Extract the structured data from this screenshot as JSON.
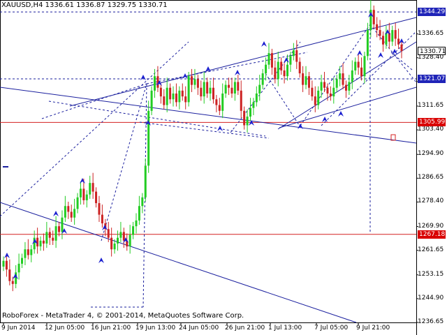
{
  "header": {
    "symbol": "XAUUSD,H4",
    "open": "1336.61",
    "high": "1336.87",
    "low": "1329.75",
    "close": "1330.71"
  },
  "footer": {
    "watermark": "RoboForex - MetaTrader 4, © 2001-2014, MetaQuotes Software Corp."
  },
  "price_axis": {
    "ticks": [
      "1336.65",
      "1328.40",
      "1320.15",
      "1311.65",
      "1303.40",
      "1294.90",
      "1286.65",
      "1278.40",
      "1269.90",
      "1261.65",
      "1253.15",
      "1244.90",
      "1236.65"
    ]
  },
  "time_axis": {
    "ticks": [
      "9 Jun 2014",
      "12 Jun 05:00",
      "16 Jun 21:00",
      "19 Jun 13:00",
      "24 Jun 05:00",
      "26 Jun 21:00",
      "1 Jul 13:00",
      "7 Jul 05:00",
      "9 Jul 21:00"
    ]
  },
  "price_labels": [
    {
      "value": "1344.29",
      "style": "resistance",
      "bg": "#1f24b8",
      "fg": "#ffffff"
    },
    {
      "value": "1330.71",
      "style": "current",
      "bg": "#ffffff",
      "fg": "#000000"
    },
    {
      "value": "1321.07",
      "style": "target",
      "bg": "#1f24b8",
      "fg": "#ffffff"
    },
    {
      "value": "1305.99",
      "style": "level",
      "bg": "#d90000",
      "fg": "#ffffff"
    },
    {
      "value": "1267.18",
      "style": "level",
      "bg": "#d90000",
      "fg": "#ffffff"
    }
  ],
  "colors": {
    "bull": "#22cc22",
    "bear": "#cc2222",
    "trend": "#1a1f9e",
    "level_red": "#d42020",
    "arrow": "#1a1fcf"
  },
  "chart_data": {
    "type": "candlestick",
    "symbol": "XAUUSD",
    "timeframe": "H4",
    "ylim": [
      1236.65,
      1349.0
    ],
    "horizontal_levels": [
      1344.29,
      1321.07,
      1305.99,
      1267.18
    ],
    "current_price": 1330.71,
    "series_close": [
      1258,
      1255,
      1251,
      1250,
      1254,
      1257,
      1259,
      1262,
      1260,
      1262,
      1266,
      1263,
      1265,
      1264,
      1268,
      1266,
      1265,
      1270,
      1268,
      1273,
      1277,
      1275,
      1273,
      1276,
      1280,
      1283,
      1279,
      1281,
      1285,
      1282,
      1278,
      1274,
      1271,
      1269,
      1266,
      1262,
      1264,
      1266,
      1268,
      1265,
      1263,
      1267,
      1270,
      1272,
      1277,
      1280,
      1291,
      1310,
      1317,
      1322,
      1318,
      1315,
      1312,
      1318,
      1314,
      1316,
      1313,
      1317,
      1315,
      1313,
      1322,
      1319,
      1321,
      1318,
      1315,
      1320,
      1316,
      1318,
      1314,
      1312,
      1310,
      1316,
      1319,
      1318,
      1316,
      1320,
      1317,
      1310,
      1305,
      1308,
      1311,
      1313,
      1316,
      1319,
      1323,
      1326,
      1330,
      1325,
      1321,
      1327,
      1324,
      1322,
      1326,
      1329,
      1331,
      1327,
      1323,
      1319,
      1322,
      1318,
      1315,
      1312,
      1317,
      1320,
      1318,
      1316,
      1315,
      1318,
      1321,
      1323,
      1319,
      1317,
      1320,
      1324,
      1327,
      1325,
      1322,
      1329,
      1338,
      1345,
      1340,
      1338,
      1336,
      1333,
      1337,
      1334,
      1338,
      1335,
      1333,
      1330.71
    ]
  }
}
